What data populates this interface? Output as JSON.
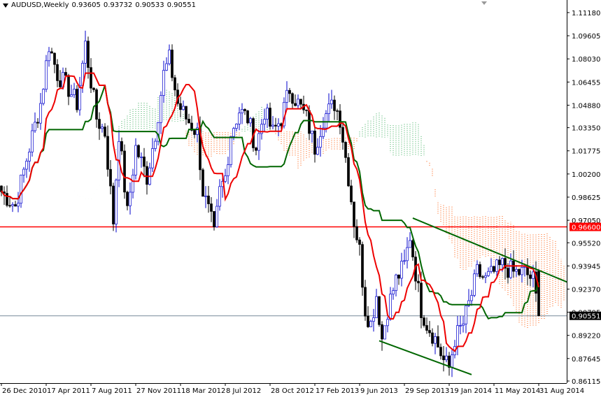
{
  "header": {
    "symbol": "AUDUSD,Weekly",
    "open": "0.93605",
    "high": "0.93732",
    "low": "0.90533",
    "close": "0.90551"
  },
  "colors": {
    "tenkan": "#ee0000",
    "kijun": "#006600",
    "cloud_bull": "#33aa55",
    "cloud_bear": "#ff5500",
    "hline": "#ff0000",
    "bid_line": "#778899",
    "trendline": "#006600"
  },
  "chart_data": {
    "type": "candlestick",
    "title": "AUDUSD,Weekly",
    "ylim": [
      0.86115,
      1.1118
    ],
    "y_ticks": [
      "1.11180",
      "1.09605",
      "1.08030",
      "1.06455",
      "1.04880",
      "1.03350",
      "1.01775",
      "1.00200",
      "0.98625",
      "0.97050",
      "0.95520",
      "0.93945",
      "0.92370",
      "0.90795",
      "0.89220",
      "0.87645",
      "0.86115"
    ],
    "x_ticks": [
      {
        "label": "26 Dec 2010",
        "week": 0
      },
      {
        "label": "17 Apr 2011",
        "week": 16
      },
      {
        "label": "7 Aug 2011",
        "week": 32
      },
      {
        "label": "27 Nov 2011",
        "week": 48
      },
      {
        "label": "18 Mar 2012",
        "week": 64
      },
      {
        "label": "8 Jul 2012",
        "week": 80
      },
      {
        "label": "28 Oct 2012",
        "week": 96
      },
      {
        "label": "17 Feb 2013",
        "week": 112
      },
      {
        "label": "9 Jun 2013",
        "week": 128
      },
      {
        "label": "29 Sep 2013",
        "week": 144
      },
      {
        "label": "19 Jan 2014",
        "week": 160
      },
      {
        "label": "11 May 2014",
        "week": 176
      },
      {
        "label": "31 Aug 2014",
        "week": 192
      }
    ],
    "close_keypoints": [
      [
        0,
        0.99
      ],
      [
        5,
        0.98
      ],
      [
        10,
        1.02
      ],
      [
        14,
        1.05
      ],
      [
        17,
        1.09
      ],
      [
        20,
        1.07
      ],
      [
        24,
        1.06
      ],
      [
        27,
        1.05
      ],
      [
        30,
        1.09
      ],
      [
        34,
        1.04
      ],
      [
        37,
        1.03
      ],
      [
        40,
        0.97
      ],
      [
        42,
        1.03
      ],
      [
        45,
        0.975
      ],
      [
        48,
        1.02
      ],
      [
        52,
        1.0
      ],
      [
        55,
        1.03
      ],
      [
        58,
        1.07
      ],
      [
        60,
        1.08
      ],
      [
        63,
        1.05
      ],
      [
        66,
        1.04
      ],
      [
        70,
        1.03
      ],
      [
        72,
        0.99
      ],
      [
        75,
        0.97
      ],
      [
        76,
        0.96
      ],
      [
        78,
        0.99
      ],
      [
        80,
        1.0
      ],
      [
        82,
        1.03
      ],
      [
        85,
        1.045
      ],
      [
        88,
        1.04
      ],
      [
        91,
        1.02
      ],
      [
        94,
        1.045
      ],
      [
        97,
        1.03
      ],
      [
        100,
        1.04
      ],
      [
        103,
        1.06
      ],
      [
        106,
        1.05
      ],
      [
        109,
        1.04
      ],
      [
        112,
        1.02
      ],
      [
        115,
        1.04
      ],
      [
        119,
        1.05
      ],
      [
        121,
        1.04
      ],
      [
        124,
        1.0
      ],
      [
        126,
        0.97
      ],
      [
        128,
        0.95
      ],
      [
        130,
        0.91
      ],
      [
        132,
        0.9
      ],
      [
        134,
        0.92
      ],
      [
        136,
        0.89
      ],
      [
        138,
        0.91
      ],
      [
        141,
        0.93
      ],
      [
        144,
        0.94
      ],
      [
        146,
        0.96
      ],
      [
        148,
        0.935
      ],
      [
        150,
        0.91
      ],
      [
        152,
        0.9
      ],
      [
        155,
        0.89
      ],
      [
        158,
        0.875
      ],
      [
        160,
        0.87
      ],
      [
        162,
        0.89
      ],
      [
        165,
        0.9
      ],
      [
        168,
        0.92
      ],
      [
        170,
        0.935
      ],
      [
        173,
        0.93
      ],
      [
        176,
        0.935
      ],
      [
        179,
        0.94
      ],
      [
        183,
        0.935
      ],
      [
        187,
        0.935
      ],
      [
        190,
        0.93
      ],
      [
        192,
        0.9055
      ]
    ],
    "indicators": [
      "Ichimoku Tenkan-sen (9)",
      "Kijun-sen (26)",
      "Kumo cloud"
    ],
    "horizontal_lines": [
      {
        "price": 0.966,
        "label": "0.96600"
      },
      {
        "price": 0.90551,
        "label": "0.90551"
      }
    ],
    "trendlines": [
      {
        "from": [
          147,
          0.972
        ],
        "to": [
          204,
          0.927
        ]
      },
      {
        "from": [
          135,
          0.8885
        ],
        "to": [
          168,
          0.8655
        ]
      }
    ]
  }
}
